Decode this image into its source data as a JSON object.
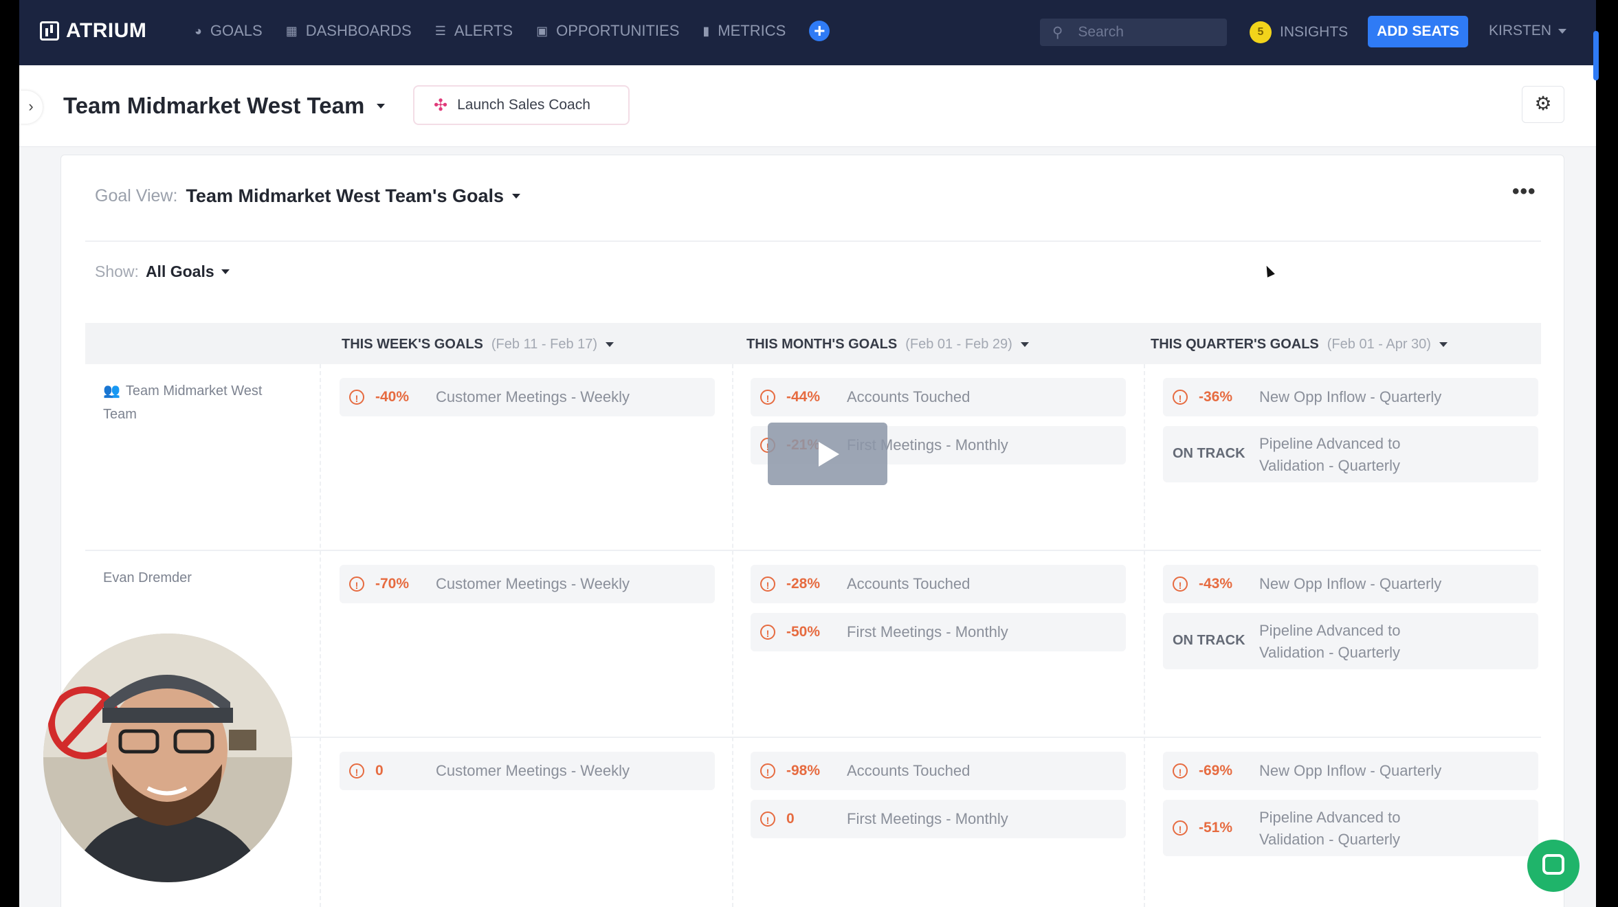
{
  "nav": {
    "brand": "ATRIUM",
    "items": [
      {
        "label": "GOALS",
        "icon": "goals-icon",
        "glyph": "◕"
      },
      {
        "label": "DASHBOARDS",
        "icon": "dashboard-icon",
        "glyph": "▦"
      },
      {
        "label": "ALERTS",
        "icon": "alerts-icon",
        "glyph": "☰"
      },
      {
        "label": "OPPORTUNITIES",
        "icon": "opportunities-icon",
        "glyph": "▣"
      },
      {
        "label": "METRICS",
        "icon": "metrics-icon",
        "glyph": "▮"
      }
    ],
    "search_placeholder": "Search",
    "insights_label": "INSIGHTS",
    "insights_count": "5",
    "add_seats_label": "ADD SEATS",
    "user_label": "KIRSTEN"
  },
  "header": {
    "team_title": "Team Midmarket West Team",
    "launch_label": "Launch Sales Coach"
  },
  "goalview": {
    "label": "Goal View:",
    "value": "Team Midmarket West Team's Goals",
    "show_label": "Show:",
    "show_value": "All Goals"
  },
  "columns": [
    {
      "title": "THIS WEEK'S GOALS",
      "range": "(Feb 11 - Feb 17)"
    },
    {
      "title": "THIS MONTH'S GOALS",
      "range": "(Feb 01 - Feb 29)"
    },
    {
      "title": "THIS QUARTER'S GOALS",
      "range": "(Feb 01 - Apr 30)"
    }
  ],
  "rows": [
    {
      "name": "Team Midmarket West Team",
      "week": [
        {
          "status": "-40%",
          "goal": "Customer Meetings - Weekly"
        }
      ],
      "month": [
        {
          "status": "-44%",
          "goal": "Accounts Touched"
        },
        {
          "status": "-21%",
          "goal": "First Meetings - Monthly"
        }
      ],
      "quarter": [
        {
          "status": "-36%",
          "goal": "New Opp Inflow - Quarterly"
        },
        {
          "status": "ON TRACK",
          "goal": "Pipeline Advanced to Validation - Quarterly"
        }
      ]
    },
    {
      "name": "Evan Dremder",
      "week": [
        {
          "status": "-70%",
          "goal": "Customer Meetings - Weekly"
        }
      ],
      "month": [
        {
          "status": "-28%",
          "goal": "Accounts Touched"
        },
        {
          "status": "-50%",
          "goal": "First Meetings - Monthly"
        }
      ],
      "quarter": [
        {
          "status": "-43%",
          "goal": "New Opp Inflow - Quarterly"
        },
        {
          "status": "ON TRACK",
          "goal": "Pipeline Advanced to Validation - Quarterly"
        }
      ]
    },
    {
      "name": "",
      "week": [
        {
          "status": "0",
          "goal": "Customer Meetings - Weekly"
        }
      ],
      "month": [
        {
          "status": "-98%",
          "goal": "Accounts Touched"
        },
        {
          "status": "0",
          "goal": "First Meetings - Monthly"
        }
      ],
      "quarter": [
        {
          "status": "-69%",
          "goal": "New Opp Inflow - Quarterly"
        },
        {
          "status": "-51%",
          "goal": "Pipeline Advanced to Validation - Quarterly"
        }
      ]
    }
  ],
  "colors": {
    "nav_bg": "#1b2440",
    "accent": "#2f7bf5",
    "warning": "#e66b40",
    "chat": "#1fb46a"
  }
}
